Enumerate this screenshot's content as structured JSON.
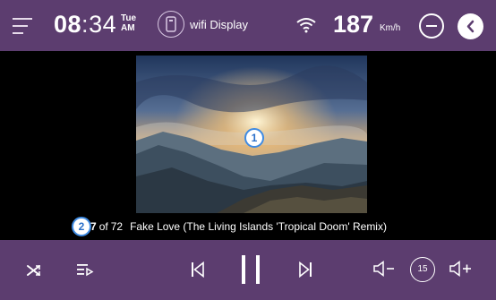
{
  "status_bar": {
    "time_hours": "08",
    "time_separator": ":",
    "time_minutes": "34",
    "day": "Tue",
    "ampm": "AM",
    "wifi_display_label": "wifi Display",
    "speed_value": "187",
    "speed_unit": "Km/h"
  },
  "now_playing": {
    "track_index": "7",
    "of_label": "of",
    "track_total": "72",
    "title": "Fake Love (The Living Islands 'Tropical Doom' Remix)"
  },
  "markers": {
    "marker1": "1",
    "marker2": "2"
  },
  "controls": {
    "skip_seconds": "15"
  },
  "colors": {
    "bar_background": "#5c3d6f",
    "marker_border": "#3f8be2",
    "content_background": "#000000"
  },
  "icons": [
    "menu-icon",
    "phone-icon",
    "wifi-icon",
    "minimize-icon",
    "back-icon",
    "shuffle-icon",
    "queue-icon",
    "previous-icon",
    "pause-icon",
    "next-icon",
    "volume-down-icon",
    "skip-15-icon",
    "volume-up-icon"
  ]
}
